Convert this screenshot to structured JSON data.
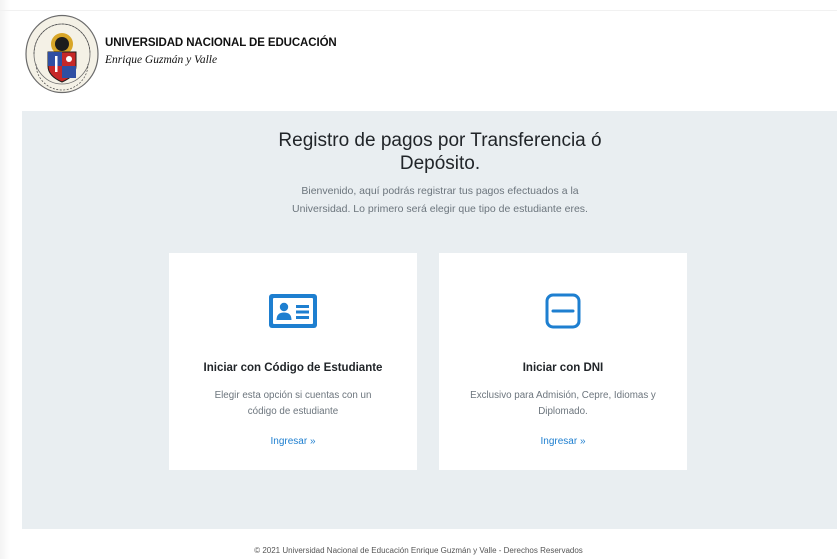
{
  "header": {
    "title": "UNIVERSIDAD NACIONAL DE EDUCACIÓN",
    "subtitle": "Enrique Guzmán y Valle",
    "seal_text": "HOMINEM UTI HOMINEM EDUCARE OPORTET"
  },
  "hero": {
    "title_lines": [
      "Registro de pagos por Transferencia ó",
      "Depósito."
    ],
    "description_lines": [
      "Bienvenido, aquí podrás registrar tus pagos efectuados a la",
      "Universidad. Lo primero será elegir que tipo de estudiante eres."
    ]
  },
  "cards": [
    {
      "icon": "id-card-icon",
      "title": "Iniciar con Código de Estudiante",
      "text_lines": [
        "Elegir esta opción si cuentas con un",
        "código de estudiante"
      ],
      "link": "Ingresar »"
    },
    {
      "icon": "dni-card-icon",
      "title": "Iniciar con DNI",
      "text_lines": [
        "Exclusivo para Admisión, Cepre, Idiomas y",
        "Diplomado."
      ],
      "link": "Ingresar »"
    }
  ],
  "footer": {
    "text": "© 2021 Universidad Nacional de Educación Enrique Guzmán y Valle - Derechos Reservados"
  },
  "colors": {
    "accent": "#1e7fd0",
    "band_background": "#e9eef1",
    "muted_text": "#6c757d"
  }
}
